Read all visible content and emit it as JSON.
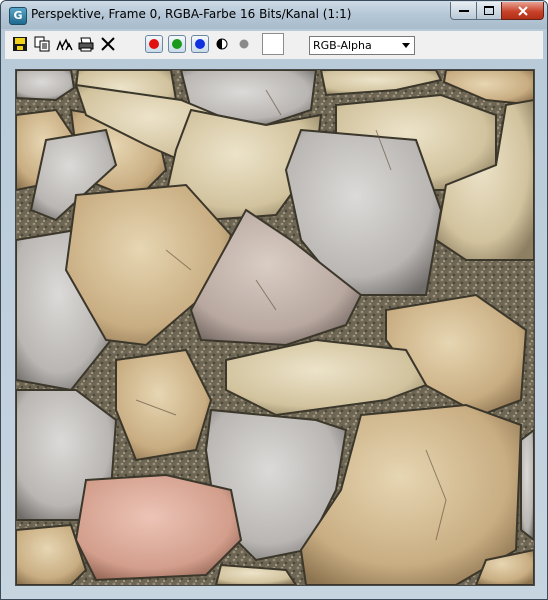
{
  "window": {
    "title": "Perspektive, Frame 0, RGBA-Farbe 16 Bits/Kanal (1:1)",
    "app_icon_letter": "G"
  },
  "toolbar": {
    "icons": [
      "save-icon",
      "copy-icon",
      "clone-icon",
      "print-icon",
      "clear-icon"
    ],
    "channels": [
      {
        "name": "red-channel-button",
        "color": "#e01010"
      },
      {
        "name": "green-channel-button",
        "color": "#1a9a1a"
      },
      {
        "name": "blue-channel-button",
        "color": "#1030e0"
      }
    ],
    "channel_display_select": {
      "value": "RGB-Alpha"
    },
    "background_swatch_color": "#ffffff"
  },
  "image": {
    "description_icon": "stone-pavement-texture",
    "colors": {
      "grout": "#6a6552",
      "stone_light": "#d8cba8",
      "stone_grey": "#c2bfbb",
      "stone_pink": "#d9a89a",
      "stone_tan": "#c9ad82"
    }
  }
}
